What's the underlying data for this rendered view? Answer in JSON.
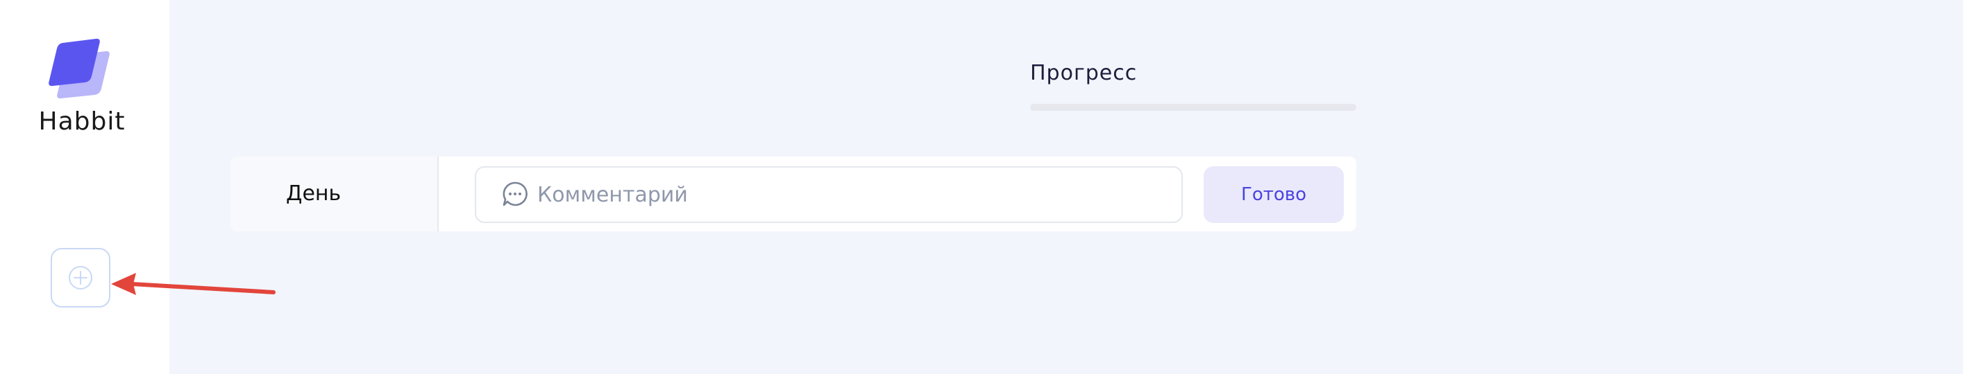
{
  "app": {
    "name": "Habbit"
  },
  "colors": {
    "accent": "#5B55F0",
    "accent_light": "#B9B6FA",
    "background": "#F2F5FC",
    "annotation_arrow": "#E2453B"
  },
  "icons": {
    "logo": "logo-icon",
    "add": "plus-circle-icon",
    "comment": "chat-bubble-icon",
    "arrow": "arrow-left-icon"
  },
  "progress": {
    "label": "Прогресс",
    "value": 0
  },
  "habit_row": {
    "day_label": "День",
    "comment_placeholder": "Комментарий",
    "comment_value": "",
    "done_label": "Готово"
  }
}
